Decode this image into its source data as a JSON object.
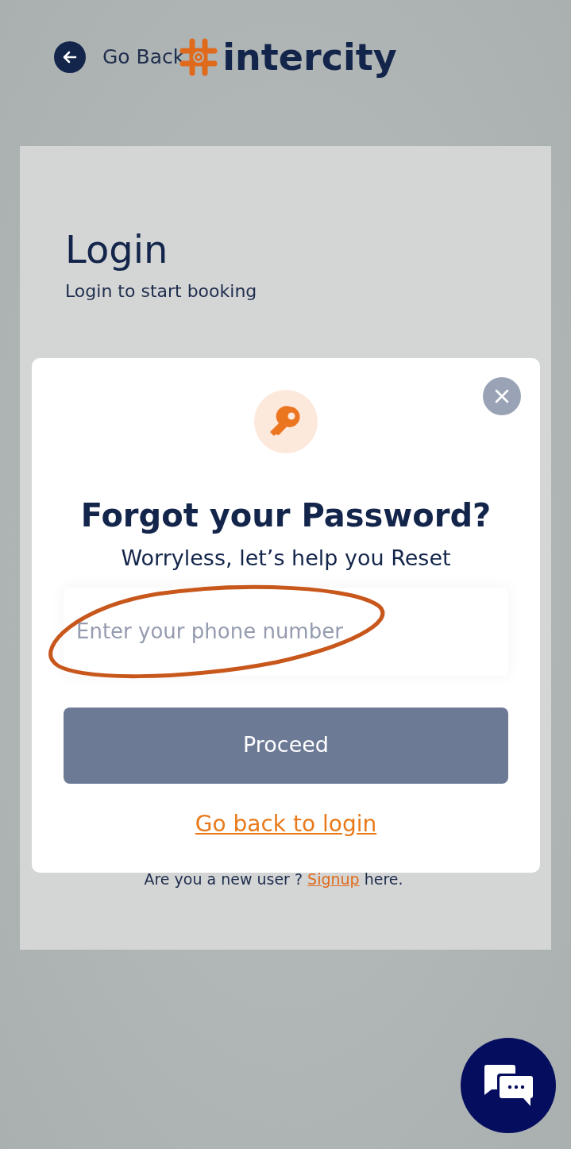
{
  "header": {
    "back_label": "Go Back",
    "logo_text": "intercity"
  },
  "login": {
    "title": "Login",
    "subtitle": "Login to start booking",
    "signup_prompt": "Are you a new user ?",
    "signup_link": "Signup",
    "signup_suffix": "here."
  },
  "modal": {
    "title": "Forgot your Password?",
    "subtitle": "Worryless, let’s help you Reset",
    "phone_field": {
      "placeholder": "Enter your phone number",
      "annotated": true
    },
    "proceed_button": "Proceed",
    "back_link": "Go back to login"
  }
}
